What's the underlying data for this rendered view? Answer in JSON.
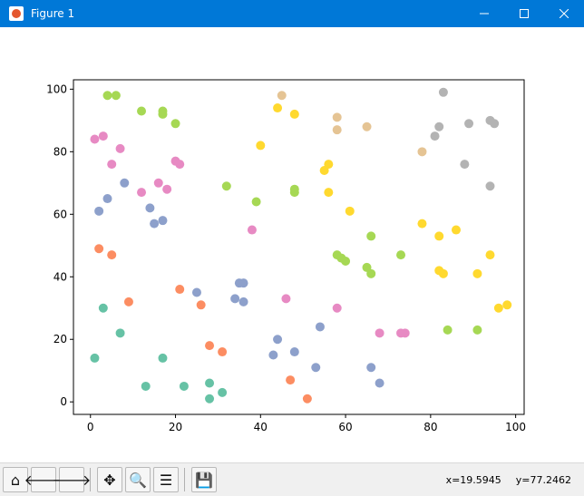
{
  "window": {
    "title": "Figure 1",
    "minimize_icon": "minimize-icon",
    "maximize_icon": "maximize-icon",
    "close_icon": "close-icon"
  },
  "toolbar": {
    "buttons": [
      {
        "name": "home-button",
        "icon": "home-icon",
        "glyph": "⌂"
      },
      {
        "name": "back-button",
        "icon": "back-arrow-icon",
        "glyph": "🡐"
      },
      {
        "name": "forward-button",
        "icon": "forward-arrow-icon",
        "glyph": "🡒"
      },
      {
        "name": "pan-button",
        "icon": "move-icon",
        "glyph": "✥"
      },
      {
        "name": "zoom-button",
        "icon": "zoom-icon",
        "glyph": "🔍"
      },
      {
        "name": "configure-subplots-button",
        "icon": "sliders-icon",
        "glyph": "☰"
      },
      {
        "name": "save-button",
        "icon": "save-icon",
        "glyph": "💾"
      }
    ],
    "x_readout": "x=19.5945",
    "y_readout": "y=77.2462"
  },
  "chart_data": {
    "type": "scatter",
    "title": "",
    "xlabel": "",
    "ylabel": "",
    "xlim": [
      -4,
      102
    ],
    "ylim": [
      -4,
      103
    ],
    "xticks": [
      0,
      20,
      40,
      60,
      80,
      100
    ],
    "yticks": [
      0,
      20,
      40,
      60,
      80,
      100
    ],
    "grid": false,
    "series": [
      {
        "color": "#66c2a5",
        "points": [
          [
            1,
            14
          ],
          [
            3,
            30
          ],
          [
            7,
            22
          ],
          [
            13,
            5
          ],
          [
            17,
            14
          ],
          [
            22,
            5
          ],
          [
            28,
            6
          ],
          [
            28,
            1
          ],
          [
            31,
            3
          ]
        ]
      },
      {
        "color": "#fc8d62",
        "points": [
          [
            2,
            49
          ],
          [
            5,
            47
          ],
          [
            9,
            32
          ],
          [
            21,
            36
          ],
          [
            26,
            31
          ],
          [
            28,
            18
          ],
          [
            31,
            16
          ],
          [
            47,
            7
          ],
          [
            51,
            1
          ]
        ]
      },
      {
        "color": "#8da0cb",
        "points": [
          [
            2,
            61
          ],
          [
            4,
            65
          ],
          [
            8,
            70
          ],
          [
            14,
            62
          ],
          [
            15,
            57
          ],
          [
            17,
            58
          ],
          [
            25,
            35
          ],
          [
            34,
            33
          ],
          [
            35,
            38
          ],
          [
            36,
            38
          ],
          [
            36,
            32
          ],
          [
            43,
            15
          ],
          [
            44,
            20
          ],
          [
            48,
            16
          ],
          [
            53,
            11
          ],
          [
            54,
            24
          ],
          [
            66,
            11
          ],
          [
            68,
            6
          ]
        ]
      },
      {
        "color": "#e78ac3",
        "points": [
          [
            1,
            84
          ],
          [
            3,
            85
          ],
          [
            5,
            76
          ],
          [
            7,
            81
          ],
          [
            12,
            67
          ],
          [
            16,
            70
          ],
          [
            18,
            68
          ],
          [
            20,
            77
          ],
          [
            21,
            76
          ],
          [
            38,
            55
          ],
          [
            46,
            33
          ],
          [
            58,
            30
          ],
          [
            68,
            22
          ],
          [
            73,
            22
          ],
          [
            74,
            22
          ]
        ]
      },
      {
        "color": "#a6d854",
        "points": [
          [
            4,
            98
          ],
          [
            6,
            98
          ],
          [
            12,
            93
          ],
          [
            17,
            93
          ],
          [
            17,
            92
          ],
          [
            20,
            89
          ],
          [
            32,
            69
          ],
          [
            39,
            64
          ],
          [
            48,
            68
          ],
          [
            48,
            67
          ],
          [
            58,
            47
          ],
          [
            59,
            46
          ],
          [
            60,
            45
          ],
          [
            65,
            43
          ],
          [
            66,
            41
          ],
          [
            66,
            53
          ],
          [
            73,
            47
          ],
          [
            84,
            23
          ],
          [
            91,
            23
          ]
        ]
      },
      {
        "color": "#ffd92f",
        "points": [
          [
            40,
            82
          ],
          [
            44,
            94
          ],
          [
            48,
            92
          ],
          [
            55,
            74
          ],
          [
            56,
            76
          ],
          [
            56,
            67
          ],
          [
            61,
            61
          ],
          [
            78,
            57
          ],
          [
            82,
            53
          ],
          [
            82,
            42
          ],
          [
            83,
            41
          ],
          [
            86,
            55
          ],
          [
            91,
            41
          ],
          [
            94,
            47
          ],
          [
            96,
            30
          ],
          [
            98,
            31
          ]
        ]
      },
      {
        "color": "#e5c494",
        "points": [
          [
            45,
            98
          ],
          [
            58,
            91
          ],
          [
            58,
            87
          ],
          [
            65,
            88
          ],
          [
            78,
            80
          ]
        ]
      },
      {
        "color": "#b3b3b3",
        "points": [
          [
            81,
            85
          ],
          [
            82,
            88
          ],
          [
            83,
            99
          ],
          [
            88,
            76
          ],
          [
            89,
            89
          ],
          [
            94,
            90
          ],
          [
            95,
            89
          ],
          [
            94,
            69
          ]
        ]
      }
    ]
  }
}
